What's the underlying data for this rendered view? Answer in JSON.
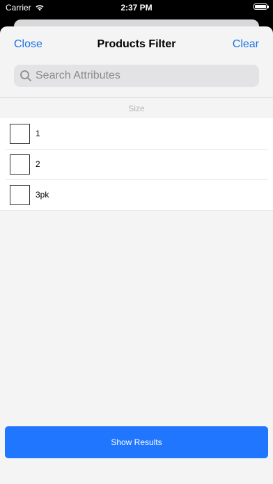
{
  "status_bar": {
    "carrier": "Carrier",
    "time": "2:37 PM",
    "icons": [
      "wifi-icon",
      "battery-icon"
    ]
  },
  "nav": {
    "close_label": "Close",
    "title": "Products Filter",
    "clear_label": "Clear"
  },
  "search": {
    "placeholder": "Search Attributes",
    "value": "",
    "icon": "search-icon"
  },
  "section": {
    "header": "Size",
    "items": [
      {
        "label": "1",
        "checked": false
      },
      {
        "label": "2",
        "checked": false
      },
      {
        "label": "3pk",
        "checked": false
      }
    ]
  },
  "footer": {
    "show_results_label": "Show Results"
  },
  "colors": {
    "accent": "#1a73e8",
    "button": "#2176ff",
    "background": "#f4f4f4"
  }
}
